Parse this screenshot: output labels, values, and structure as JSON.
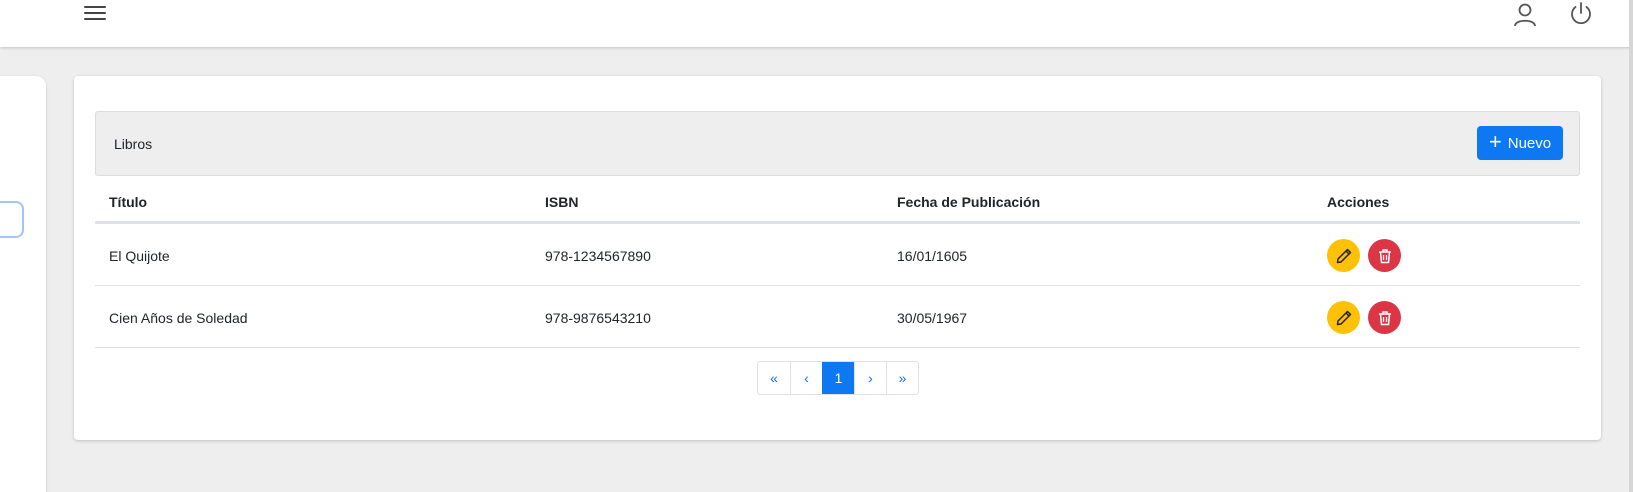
{
  "topbar": {
    "menu_icon": "hamburger-menu-icon",
    "user_icon": "user-icon",
    "power_icon": "power-icon"
  },
  "card": {
    "title": "Libros",
    "new_button_label": "Nuevo",
    "new_button_icon": "plus-icon"
  },
  "table": {
    "headers": [
      "Título",
      "ISBN",
      "Fecha de Publicación",
      "Acciones"
    ],
    "rows": [
      {
        "titulo": "El Quijote",
        "isbn": "978-1234567890",
        "fecha": "16/01/1605"
      },
      {
        "titulo": "Cien Años de Soledad",
        "isbn": "978-9876543210",
        "fecha": "30/05/1967"
      }
    ],
    "row_actions": [
      "pencil-edit-icon",
      "trash-delete-icon"
    ]
  },
  "pagination": {
    "first": "«",
    "prev": "‹",
    "current_page": "1",
    "next": "›",
    "last": "»"
  },
  "colors": {
    "primary": "#0d78f2",
    "edit": "#ffc107",
    "delete": "#dc3545",
    "background": "#eeeeee"
  }
}
